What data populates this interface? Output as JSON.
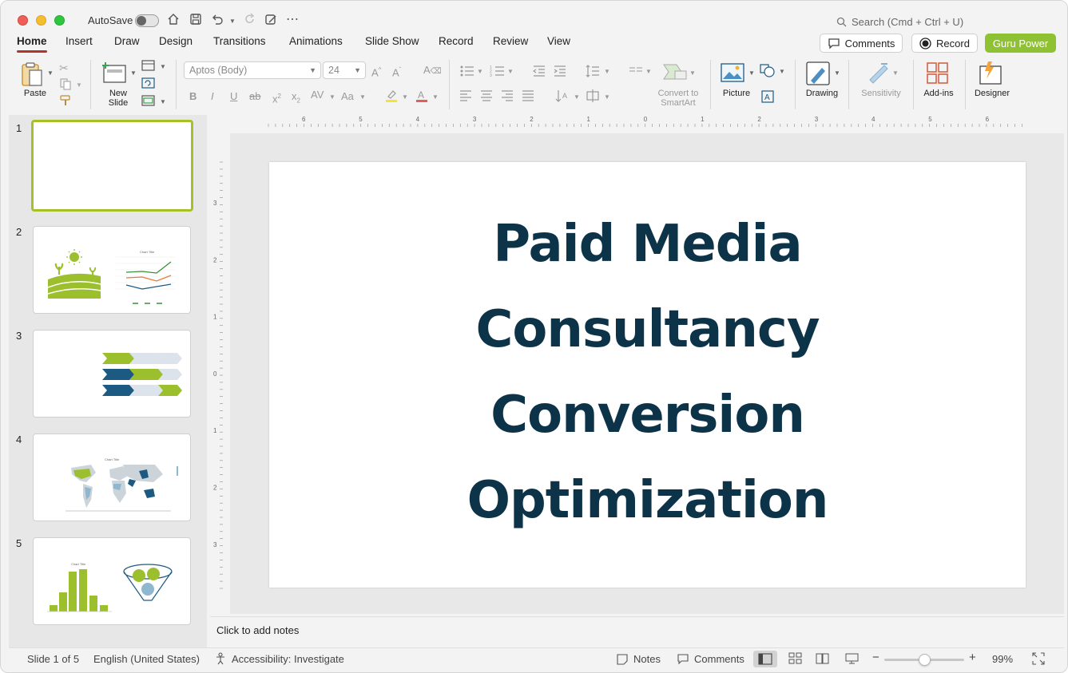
{
  "window": {
    "autosave_label": "AutoSave",
    "search_placeholder": "Search (Cmd + Ctrl + U)"
  },
  "ribbon": {
    "tabs": [
      "Home",
      "Insert",
      "Draw",
      "Design",
      "Transitions",
      "Animations",
      "Slide Show",
      "Record",
      "Review",
      "View"
    ],
    "active_tab": "Home",
    "comments_label": "Comments",
    "record_label": "Record",
    "guru_label": "Guru Power",
    "guru_color": "#8fc232",
    "accent_color": "#b0352a"
  },
  "toolbar": {
    "paste_label": "Paste",
    "new_slide_label": "New Slide",
    "font_name": "Aptos (Body)",
    "font_size": "24",
    "convert_smartart_label": "Convert to SmartArt",
    "picture_label": "Picture",
    "drawing_label": "Drawing",
    "sensitivity_label": "Sensitivity",
    "addins_label": "Add-ins",
    "designer_label": "Designer"
  },
  "ruler": {
    "h_labels": [
      "6",
      "5",
      "4",
      "3",
      "2",
      "1",
      "0",
      "1",
      "2",
      "3",
      "4",
      "5",
      "6"
    ],
    "v_labels": [
      "3",
      "2",
      "1",
      "0",
      "1",
      "2",
      "3"
    ]
  },
  "slides": {
    "numbers": [
      "1",
      "2",
      "3",
      "4",
      "5"
    ],
    "thumb2_chart_title": "Chart Title",
    "thumb4_chart_title": "Chart Title",
    "thumb5_chart_title": "Chart Title",
    "brand_green": "#9cbf2d",
    "brand_navy": "#1d5a83"
  },
  "slide": {
    "title_lines": [
      "Paid Media",
      "Consultancy",
      "Conversion",
      "Optimization"
    ],
    "title_color": "#0d3349"
  },
  "notes_placeholder": "Click to add notes",
  "status": {
    "slide_count": "Slide 1 of 5",
    "language": "English (United States)",
    "accessibility": "Accessibility: Investigate",
    "notes_label": "Notes",
    "comments_label": "Comments",
    "zoom_minus": "−",
    "zoom_plus": "+",
    "zoom_percent": "99%",
    "zoom_level": 0.99
  }
}
